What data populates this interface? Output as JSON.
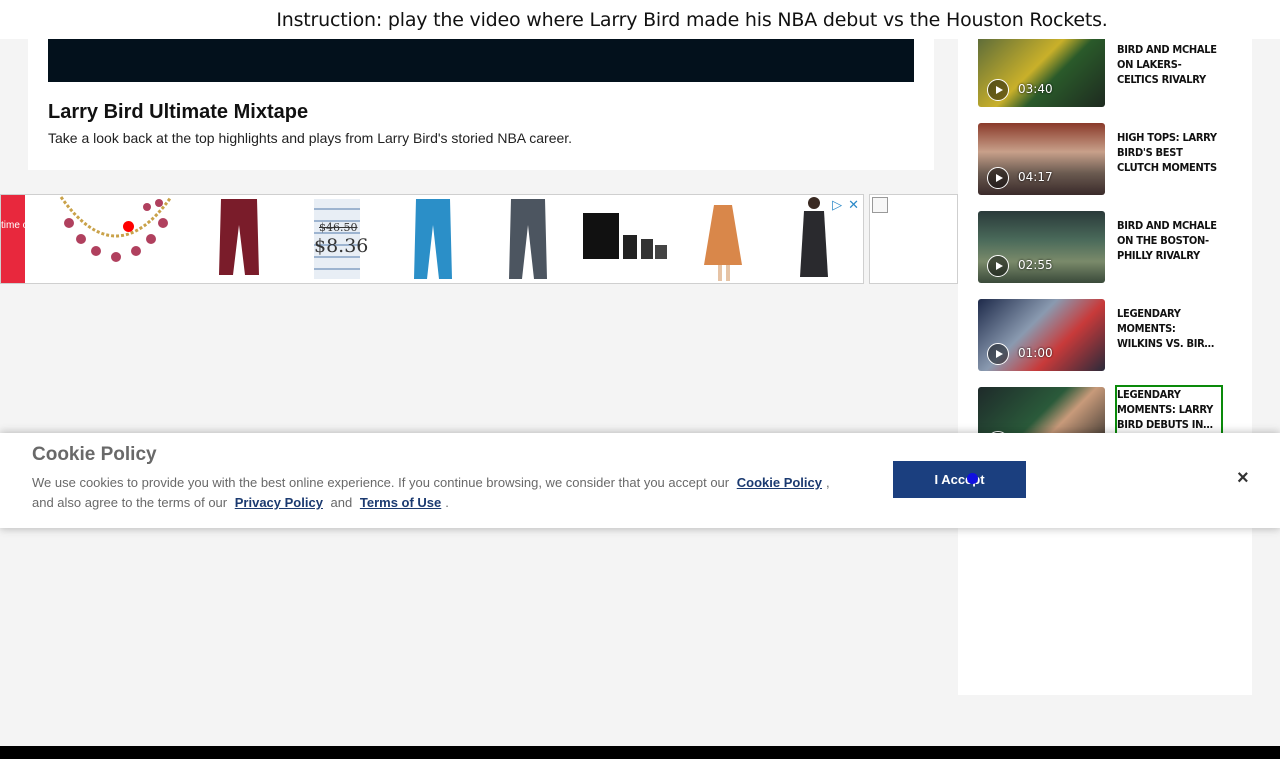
{
  "instruction": "Instruction: play the video where Larry Bird made his NBA debut vs the Houston Rockets.",
  "main_video": {
    "title": "Larry Bird Ultimate Mixtape",
    "description": "Take a look back at the top highlights and plays from Larry Bird's storied NBA career."
  },
  "ad": {
    "red_text": "time ons",
    "price_old": "$46.50",
    "price_new": "$8.36",
    "choices_icon": "adchoices-icon",
    "close_icon": "close-icon"
  },
  "sidebar": {
    "items": [
      {
        "title": "Bird and McHale on Lakers-Celtics Rivalry",
        "duration": "03:40"
      },
      {
        "title": "High Tops: Larry Bird's Best Clutch Moments",
        "duration": "04:17"
      },
      {
        "title": "Bird and McHale on the Boston-Philly Rivalry",
        "duration": "02:55"
      },
      {
        "title": "Legendary Moments: Wilkins vs. Bir…",
        "duration": "01:00"
      },
      {
        "title": "Legendary Moments: Larry Bird Debuts In…",
        "duration": ""
      }
    ]
  },
  "cookie": {
    "title": "Cookie Policy",
    "text_part1": "We use cookies to provide you with the best online experience. If you continue browsing, we consider that you accept our",
    "link_cookie": "Cookie Policy",
    "text_part2": ", and also agree to the terms of our",
    "link_privacy": "Privacy Policy",
    "text_and": "and",
    "link_terms": "Terms of Use",
    "text_end": ".",
    "accept_label": "I Accept",
    "close_label": "×"
  },
  "colors": {
    "accept_button": "#1b3f7f",
    "highlight_outline": "#0a8a0a",
    "video_bg": "#03111c",
    "ad_red": "#e8283d"
  }
}
